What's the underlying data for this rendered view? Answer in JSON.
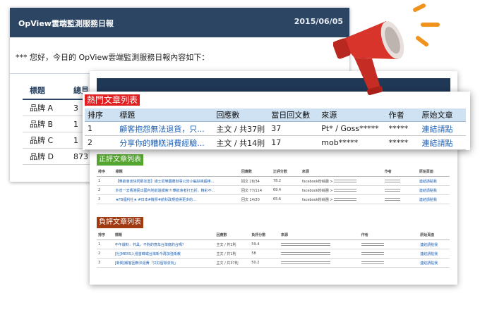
{
  "back_card": {
    "title": "OpView雲端監測服務日報",
    "date": "2015/06/05",
    "greeting": "*** 您好，今日的 OpView雲端監測服務日報內容如下：",
    "table": {
      "headers": [
        "標題",
        "總量"
      ],
      "header_visible": [
        "標題",
        "總見"
      ],
      "rows": [
        {
          "brand": "品牌 A",
          "total": "3"
        },
        {
          "brand": "品牌 B",
          "total": "1"
        },
        {
          "brand": "品牌 C",
          "total": "1"
        },
        {
          "brand": "品牌 D",
          "total": "873"
        }
      ]
    }
  },
  "hot": {
    "title": "熱門文章列表",
    "headers": [
      "排序",
      "標題",
      "回應數",
      "當日回文數",
      "來源",
      "作者",
      "原始文章"
    ],
    "rows": [
      {
        "rank": "1",
        "title": "顧客抱怨無法退貨，只...",
        "replies": "主文 / 共37則",
        "today": "37",
        "source": "Pt* / Goss*****",
        "author": "*****",
        "link": "連結請點"
      },
      {
        "rank": "2",
        "title": "分享你的糟糕消費經驗...",
        "replies": "主文 / 共14則",
        "today": "17",
        "source": "mob*****",
        "author": "*****",
        "link": "連結請點"
      }
    ]
  },
  "positive": {
    "title": "正評文章列表",
    "headers": [
      "排序",
      "標題",
      "回應數",
      "正評分數",
      "來源",
      "作者",
      "原始頁面"
    ],
    "rows": [
      {
        "rank": "1",
        "title": "【華航會走快閃那定案】總士尼樂園專辦事公告小編好爽超棒...",
        "replies": "回文 28/34",
        "score": "78.2",
        "source": "facebook粉絲團 >",
        "link": "連結請點我"
      },
      {
        "rank": "2",
        "title": "外曾一去香港民出國內地前邊摸索!!!華航會者打五折，精彩不...",
        "replies": "回文 77/114",
        "score": "69.4",
        "source": "facebook粉絲團 >",
        "link": "連結請點我"
      },
      {
        "rank": "3",
        "title": "★FB福利社★ #日本#機票#航科政規值得更多的...",
        "replies": "回文 14/20",
        "score": "65.6",
        "source": "facebook粉絲團 >",
        "link": "連結請點我"
      }
    ]
  },
  "negative": {
    "title": "負評文章列表",
    "headers": [
      "排序",
      "標題",
      "回應數",
      "負評分數",
      "來源",
      "作者",
      "原始頁面"
    ],
    "rows": [
      {
        "rank": "1",
        "title": "中午爆料：共具，不對的意年台灣底的台嗎？",
        "replies": "主文 / 共1則",
        "score": "59.4",
        "link": "連結請點我"
      },
      {
        "rank": "2",
        "title": "[社]MERS入侵首韓或台灣新今再加強衛教",
        "replies": "主文 / 共1則",
        "score": "58",
        "link": "連結請點我"
      },
      {
        "rank": "3",
        "title": "[新聞]報客因無法退費「只好留除去玩」",
        "replies": "主文 / 共37則",
        "score": "50.2",
        "link": "連結請點我"
      }
    ]
  },
  "colors": {
    "header_navy": "#2c4563",
    "hot_red": "#e02020",
    "positive_green": "#55a630",
    "negative_brown": "#a03a12",
    "link_blue": "#1b5fb5",
    "megaphone_red": "#d9342b",
    "rays_orange": "#f0931e"
  },
  "icons": [
    "megaphone-icon"
  ]
}
